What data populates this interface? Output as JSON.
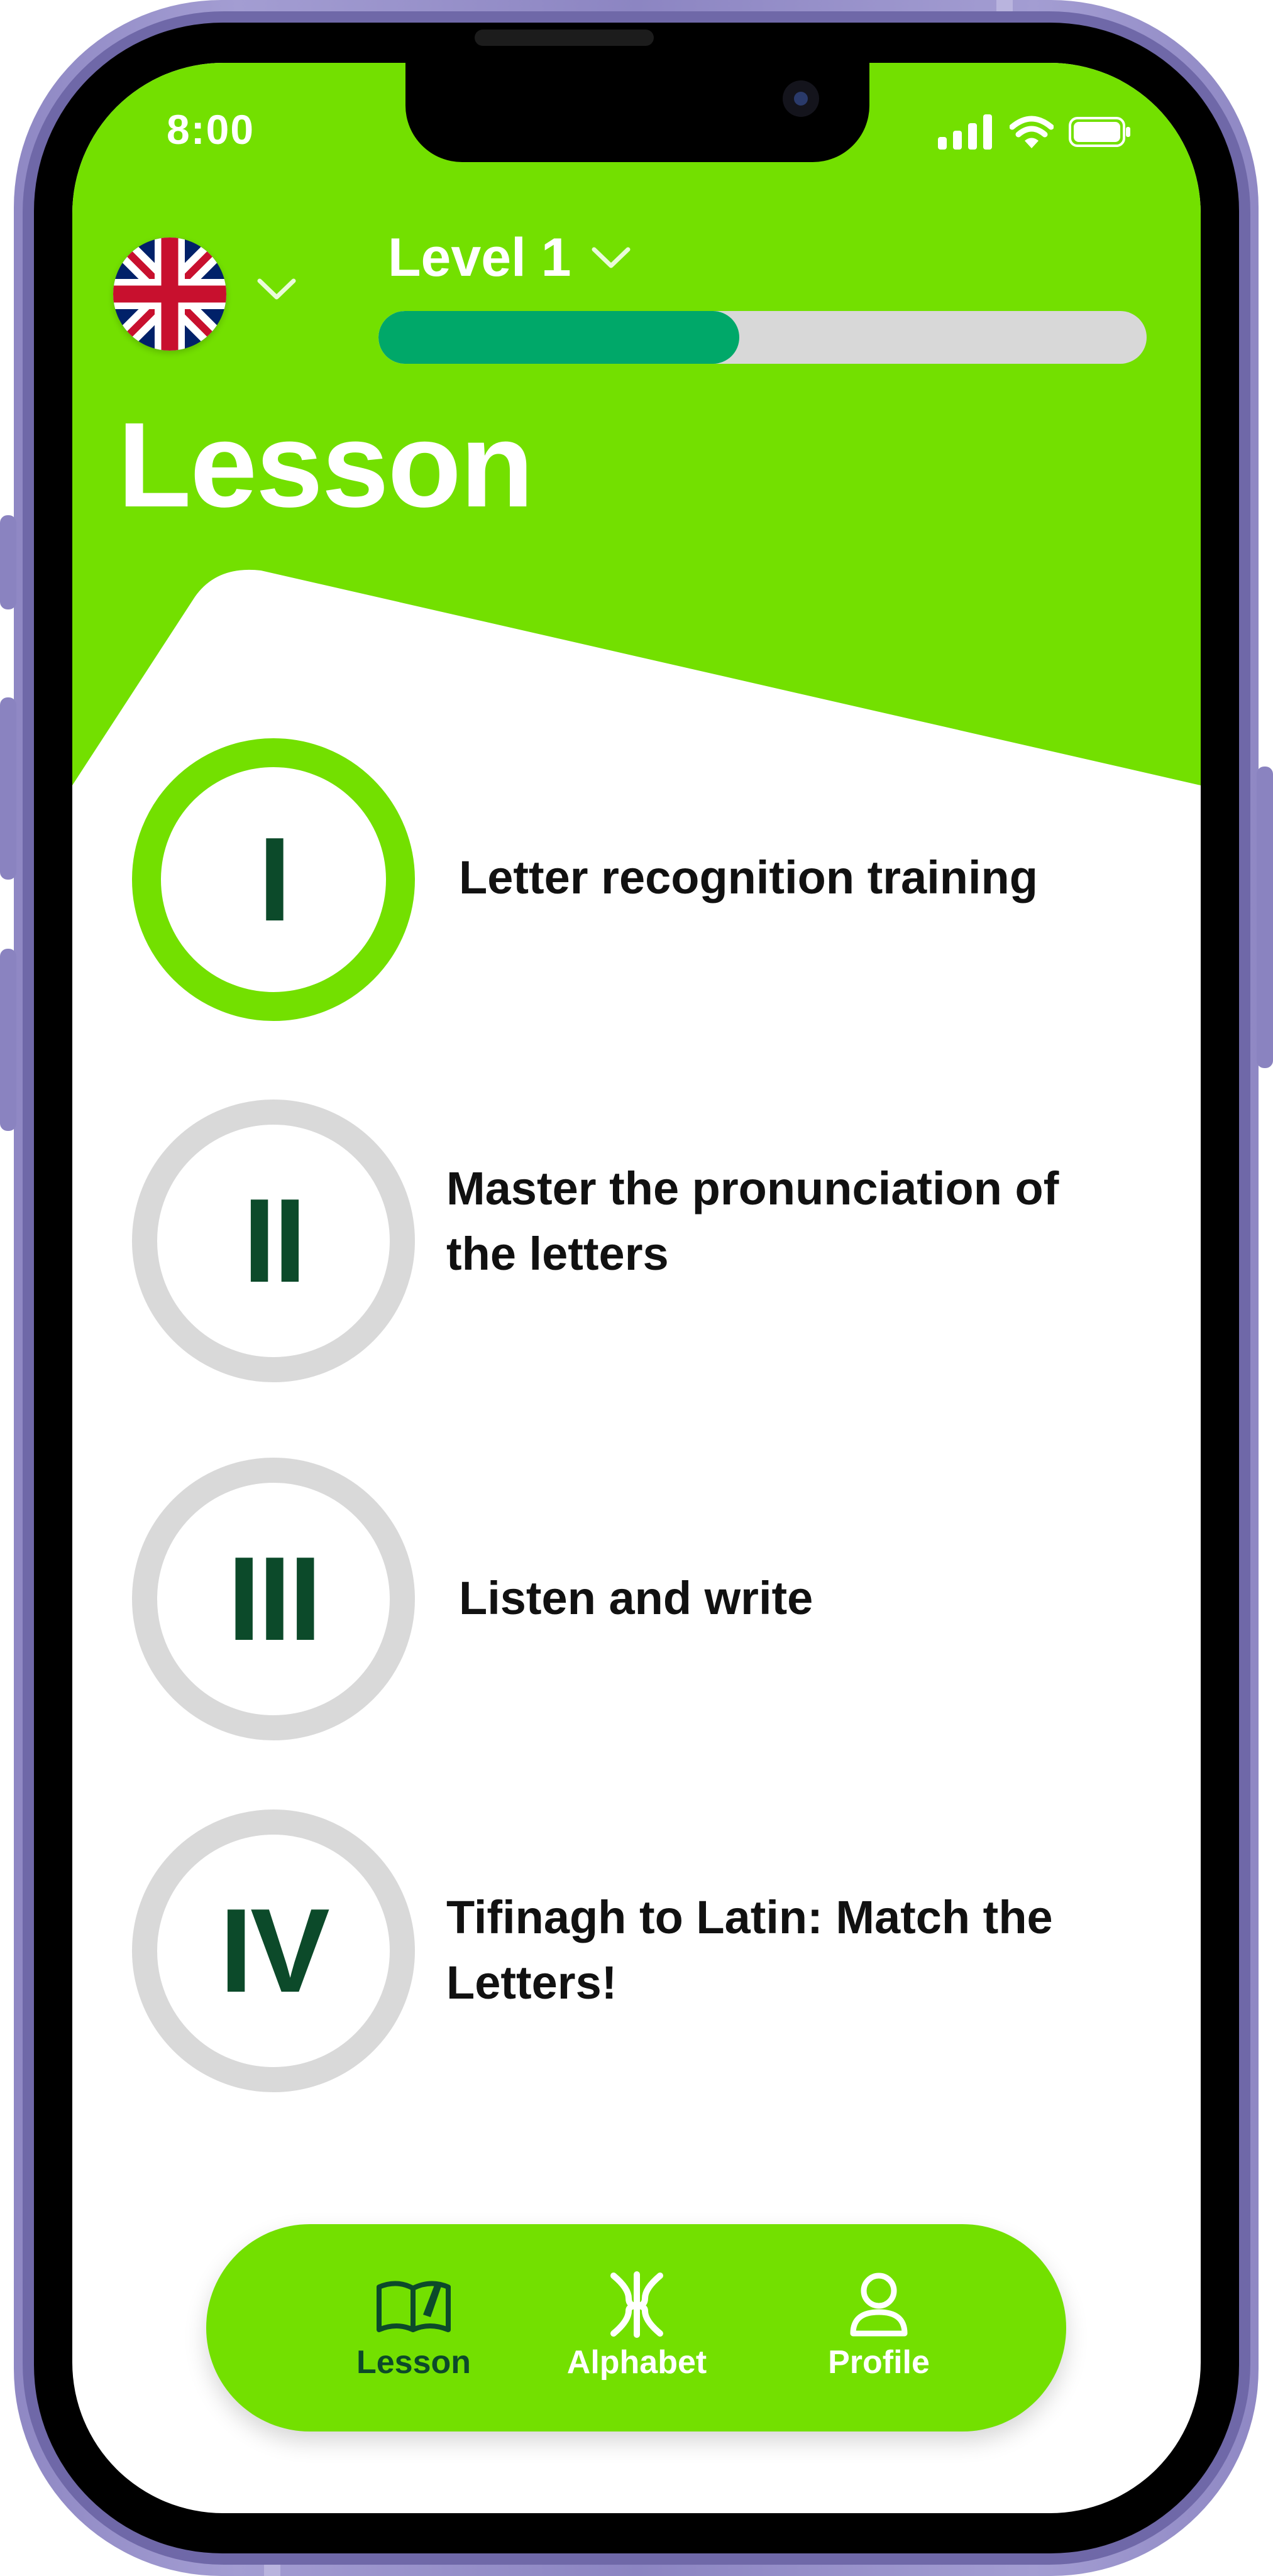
{
  "status_bar": {
    "time": "8:00",
    "signal_icon": "cellular-signal-icon",
    "wifi_icon": "wifi-icon",
    "battery_icon": "battery-icon"
  },
  "header": {
    "language_flag": "uk-flag-icon",
    "language_dropdown_icon": "chevron-down-icon",
    "level_label": "Level 1",
    "level_dropdown_icon": "chevron-down-icon",
    "level_progress_percent": 47,
    "title": "Lesson"
  },
  "lessons": [
    {
      "numeral": "I",
      "label": "Letter recognition training",
      "state": "active"
    },
    {
      "numeral": "II",
      "label": "Master the pronunciation of the letters",
      "state": "locked"
    },
    {
      "numeral": "III",
      "label": "Listen and write",
      "state": "locked"
    },
    {
      "numeral": "IV",
      "label": "Tifinagh to Latin: Match the Letters!",
      "state": "locked"
    }
  ],
  "bottom_nav": {
    "items": [
      {
        "label": "Lesson",
        "icon": "open-book-icon",
        "active": true
      },
      {
        "label": "Alphabet",
        "icon": "tifinagh-yaz-icon",
        "active": false
      },
      {
        "label": "Profile",
        "icon": "user-icon",
        "active": false
      }
    ]
  },
  "colors": {
    "brand_green": "#73e000",
    "progress_green": "#00a869",
    "dark_green": "#0c4a2a",
    "locked_gray": "#d9d9d9",
    "device_frame": "#9a93cc"
  }
}
